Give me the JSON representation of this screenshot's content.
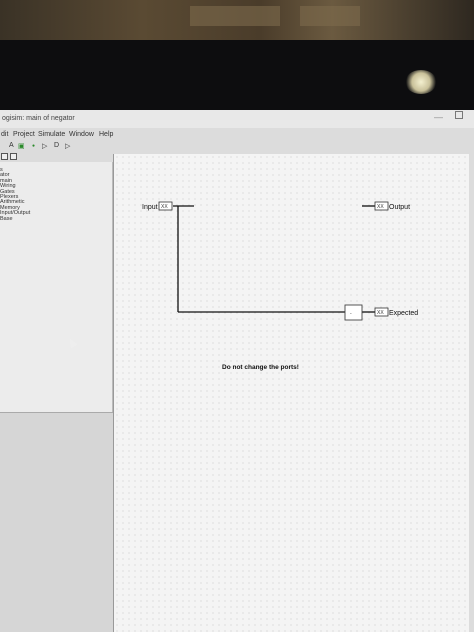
{
  "window": {
    "title": "ogisim: main of negator"
  },
  "menu": {
    "items": [
      "dit",
      "Project",
      "Simulate",
      "Window",
      "Help"
    ]
  },
  "toolbar": {
    "items": [
      "A",
      "▣",
      "●",
      "▷",
      "D",
      "▷"
    ]
  },
  "explorer": {
    "items": [
      "s",
      "ator",
      "main",
      "Wiring",
      "Gates",
      "Plexers",
      "Arithmetic",
      "Memory",
      "Input/Output",
      "Base"
    ]
  },
  "circuit": {
    "input_label": "Input",
    "output_label": "Output",
    "expected_label": "Expected",
    "pin_value": "XX",
    "note": "Do not change the ports!"
  },
  "colors": {
    "wire": "#111111",
    "canvas": "#f4f4f4",
    "panel": "#ececec"
  }
}
